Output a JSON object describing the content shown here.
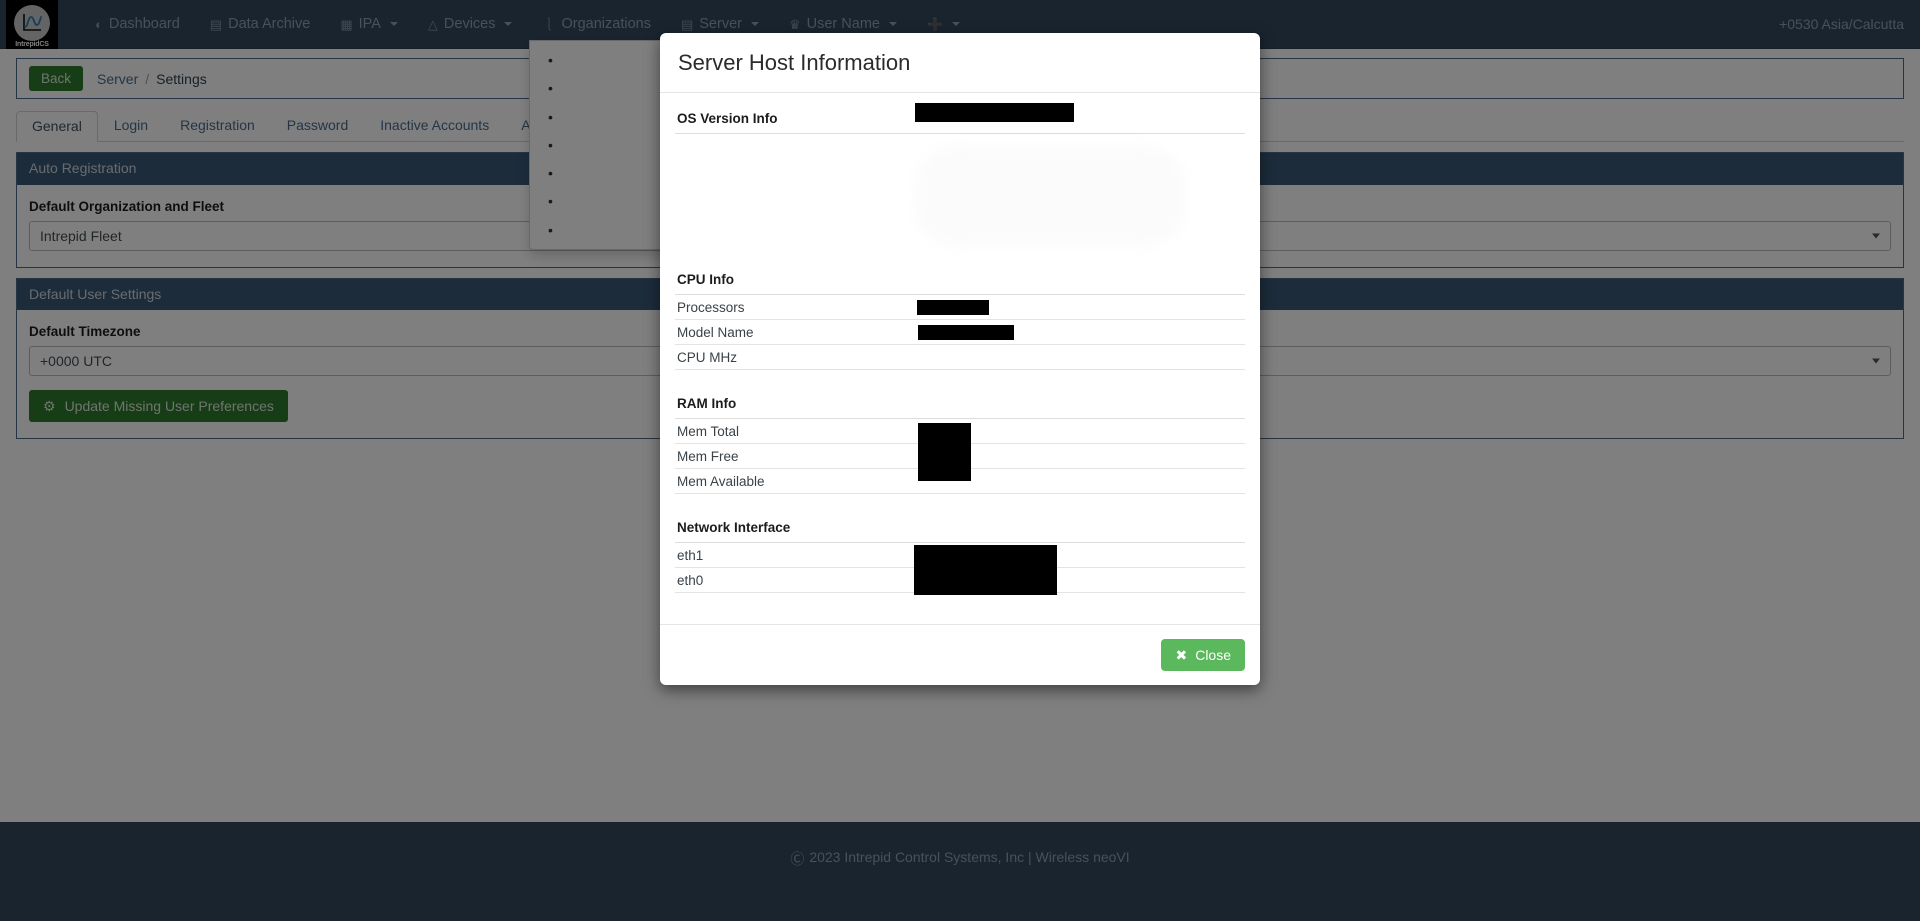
{
  "navbar": {
    "brand_label": "IntrepidCS",
    "brand_icon": "waveform-logo-icon",
    "items": [
      {
        "label": "Dashboard",
        "icon": "dashboard-icon",
        "glyph": "◔",
        "caret": false
      },
      {
        "label": "Data Archive",
        "icon": "archive-icon",
        "glyph": "⌸",
        "caret": false
      },
      {
        "label": "IPA",
        "icon": "ipa-icon",
        "glyph": "☰",
        "caret": true
      },
      {
        "label": "Devices",
        "icon": "device-icon",
        "glyph": "▲",
        "caret": true
      },
      {
        "label": "Organizations",
        "icon": "organizations-icon",
        "glyph": "⑂",
        "caret": false
      },
      {
        "label": "Server",
        "icon": "server-icon",
        "glyph": "☰",
        "caret": true
      },
      {
        "label": "User Name",
        "icon": "crown-icon",
        "glyph": "♛",
        "caret": true
      },
      {
        "label": "",
        "icon": "plus-icon",
        "glyph": "＋",
        "caret": true
      }
    ],
    "timezone": "+0530 Asia/Calcutta"
  },
  "toolbar": {
    "back_label": "Back",
    "breadcrumb": {
      "parent": "Server",
      "separator": "/",
      "current": "Settings"
    }
  },
  "tabs": [
    {
      "label": "General",
      "active": true
    },
    {
      "label": "Login",
      "active": false
    },
    {
      "label": "Registration",
      "active": false
    },
    {
      "label": "Password",
      "active": false
    },
    {
      "label": "Inactive Accounts",
      "active": false
    },
    {
      "label": "Appearance",
      "active": false
    }
  ],
  "panels": [
    {
      "title": "Auto Registration",
      "field_label": "Default Organization and Fleet",
      "field_value": "Intrepid Fleet"
    },
    {
      "title": "Default User Settings",
      "field_label": "Default Timezone",
      "field_value": "+0000 UTC",
      "button_label": "Update Missing User Preferences",
      "button_icon": "gears-icon"
    }
  ],
  "hidden_dropdown": {
    "items": [
      "•",
      "•",
      "•",
      "•",
      "•",
      "•",
      "•"
    ]
  },
  "modal": {
    "title": "Server Host Information",
    "sections": [
      {
        "heading": "OS Version Info",
        "heading_redacted": true,
        "rows": []
      },
      {
        "heading": "CPU Info",
        "heading_redacted": false,
        "rows": [
          {
            "key": "Processors",
            "value": "",
            "redacted": true,
            "redact_w": 72
          },
          {
            "key": "Model Name",
            "value": "",
            "redacted": true,
            "redact_w": 96
          },
          {
            "key": "CPU MHz",
            "value": "",
            "redacted": false,
            "redact_w": 0
          }
        ]
      },
      {
        "heading": "RAM Info",
        "heading_redacted": false,
        "rows": [
          {
            "key": "Mem Total",
            "value": "",
            "redacted": false,
            "redact_w": 0
          },
          {
            "key": "Mem Free",
            "value": "",
            "redacted": false,
            "redact_w": 0
          },
          {
            "key": "Mem Available",
            "value": "",
            "redacted": false,
            "redact_w": 0
          }
        ]
      },
      {
        "heading": "Network Interface",
        "heading_redacted": false,
        "rows": [
          {
            "key": "eth1",
            "value": "",
            "redacted": false,
            "redact_w": 0
          },
          {
            "key": "eth0",
            "value": "",
            "redacted": false,
            "redact_w": 0
          }
        ]
      }
    ],
    "close_label": "Close",
    "close_icon": "x-icon"
  },
  "footer": {
    "copyright_icon": "copyright-icon",
    "text": "2023 Intrepid Control Systems, Inc | Wireless neoVI"
  },
  "colors": {
    "navbar_bg": "#34495e",
    "panel_head_bg": "#3a5877",
    "green_button": "#2c7a2c",
    "close_green": "#5cb85c",
    "link_blue": "#4b6b8a",
    "backdrop": "rgba(0,0,0,0.5)"
  }
}
